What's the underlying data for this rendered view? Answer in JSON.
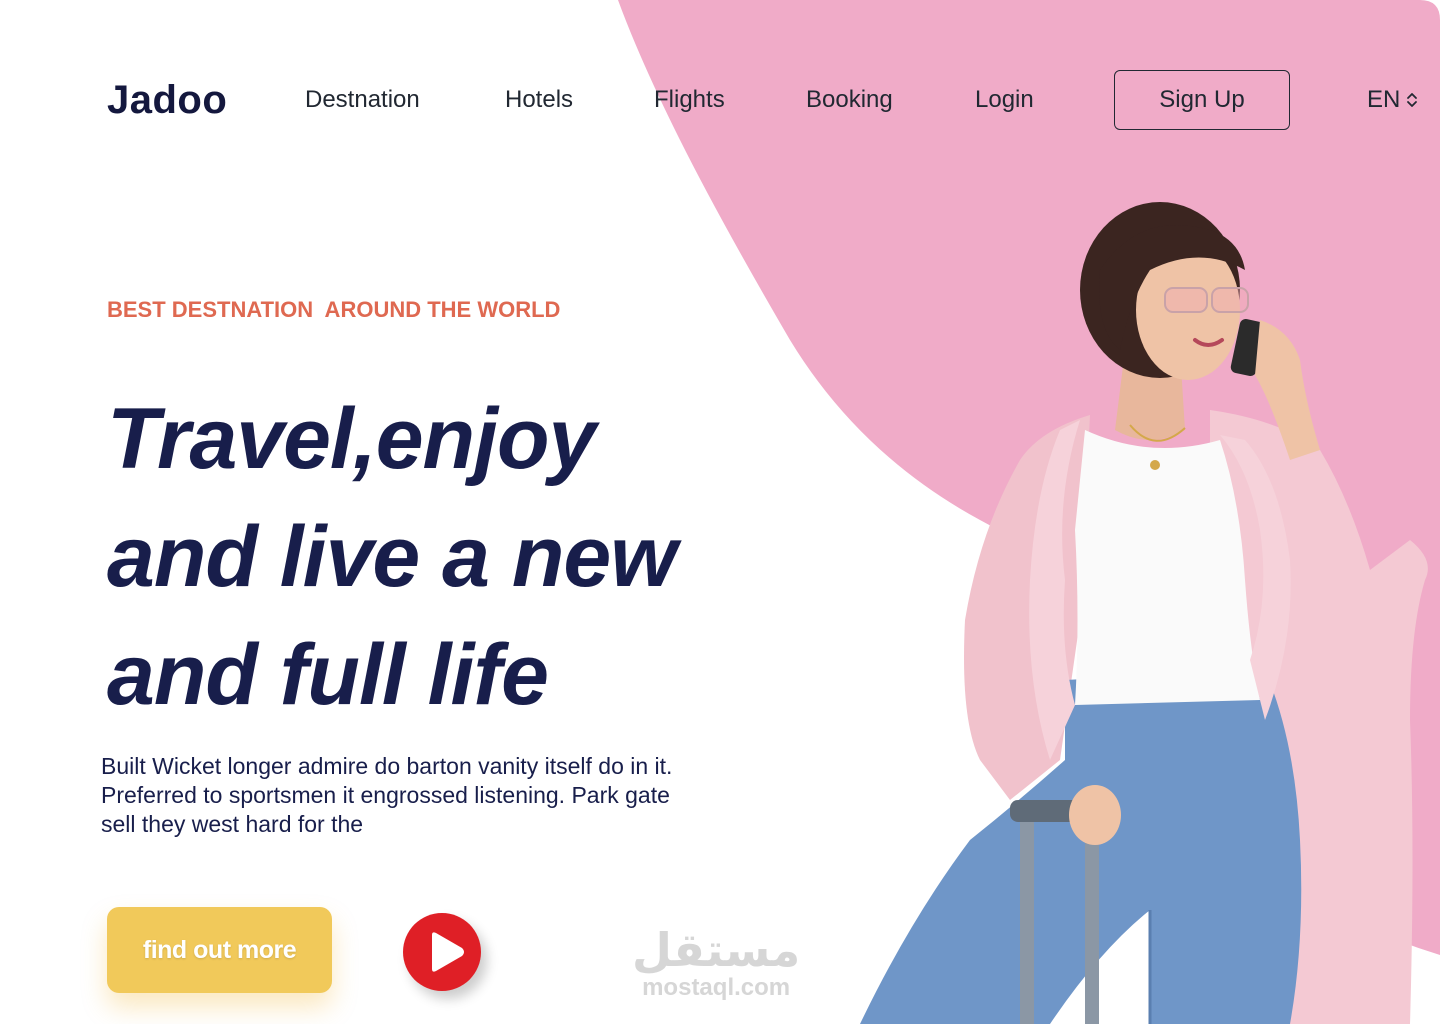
{
  "header": {
    "logo": "Jadoo",
    "nav": [
      {
        "label": "Destnation"
      },
      {
        "label": "Hotels"
      },
      {
        "label": "Flights"
      },
      {
        "label": "Booking"
      },
      {
        "label": "Login"
      }
    ],
    "signup_label": "Sign Up",
    "language": "EN"
  },
  "hero": {
    "eyebrow": "BEST DESTNATION  AROUND THE WORLD",
    "headline_lines": [
      "Travel,enjoy",
      "and live a new",
      "and full life"
    ],
    "description_lines": [
      "Built Wicket longer admire do barton vanity itself do in it.",
      "Preferred to sportsmen it engrossed listening. Park gate",
      "sell they west hard for the"
    ],
    "cta_label": "find out more",
    "play_icon": "play-icon"
  },
  "watermark": {
    "arabic": "مستقل",
    "latin": "mostaql.com"
  },
  "colors": {
    "brand_navy": "#181E4B",
    "accent_orange": "#DF6951",
    "cta_yellow": "#F1C95A",
    "blob_pink": "#F0ABC8",
    "play_red": "#DF1F26"
  }
}
